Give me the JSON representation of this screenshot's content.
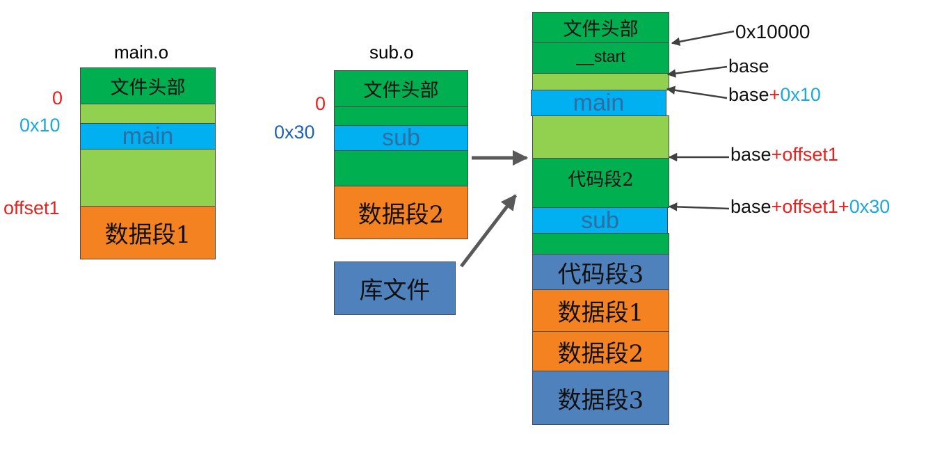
{
  "main_o": {
    "title": "main.o",
    "header": "文件头部",
    "func": "main",
    "data_seg": "数据段1",
    "addr_zero": "0",
    "addr_func": "0x10",
    "addr_data": "offset1"
  },
  "sub_o": {
    "title": "sub.o",
    "header": "文件头部",
    "func": "sub",
    "data_seg": "数据段2",
    "addr_zero": "0",
    "addr_func": "0x30"
  },
  "library": {
    "label": "库文件"
  },
  "output": {
    "header": "文件头部",
    "start": "__start",
    "main": "main",
    "code2": "代码段2",
    "sub": "sub",
    "code3": "代码段3",
    "data1": "数据段1",
    "data2": "数据段2",
    "data3": "数据段3"
  },
  "annotations": {
    "load_addr": "0x10000",
    "base": "base",
    "base_main": {
      "base": "base",
      "plus": "+",
      "off": "0x10"
    },
    "base_code2": {
      "base": "base",
      "plus": "+",
      "off": "offset1"
    },
    "base_sub": {
      "base": "base",
      "plus1": "+",
      "off1": "offset1",
      "plus2": "+",
      "off2": "0x30"
    }
  },
  "colors": {
    "code_dark_green": "#00b050",
    "code_light_green": "#92d050",
    "function_blue": "#00b0f0",
    "data_orange": "#f58220",
    "library_steel_blue": "#4f81bd",
    "address_red": "#e8201e",
    "address_cyan": "#1ba8e0",
    "arrow_gray": "#595959"
  }
}
